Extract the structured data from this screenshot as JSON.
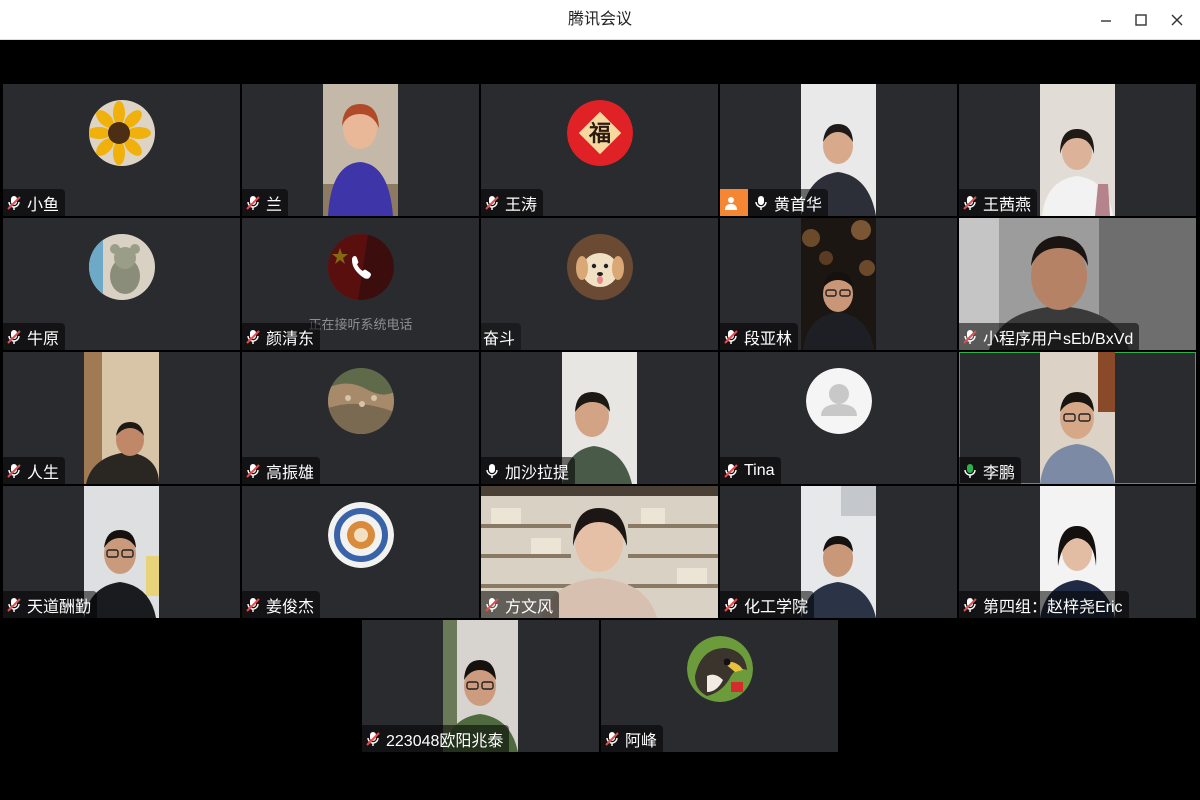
{
  "window": {
    "title": "腾讯会议"
  },
  "participants": [
    {
      "name": "小鱼"
    },
    {
      "name": "兰"
    },
    {
      "name": "王涛"
    },
    {
      "name": "黄首华"
    },
    {
      "name": "王茜燕"
    },
    {
      "name": "牛原"
    },
    {
      "name": "颜清东",
      "status": "正在接听系统电话"
    },
    {
      "name": "奋斗"
    },
    {
      "name": "段亚林"
    },
    {
      "name": "小程序用户sEb/BxVd"
    },
    {
      "name": "人生"
    },
    {
      "name": "高振雄"
    },
    {
      "name": "加沙拉提"
    },
    {
      "name": "Tina"
    },
    {
      "name": "李鹏"
    },
    {
      "name": "天道酬勤"
    },
    {
      "name": "姜俊杰"
    },
    {
      "name": "方文风"
    },
    {
      "name": "化工学院"
    },
    {
      "name": "第四组：赵梓尧Eric"
    },
    {
      "name": "223048欧阳兆泰"
    },
    {
      "name": "阿峰"
    }
  ],
  "fu_character": "福",
  "colors": {
    "active_border": "#2bb24c",
    "mic_muted": "#e64c4c",
    "share_badge": "#f58634"
  }
}
